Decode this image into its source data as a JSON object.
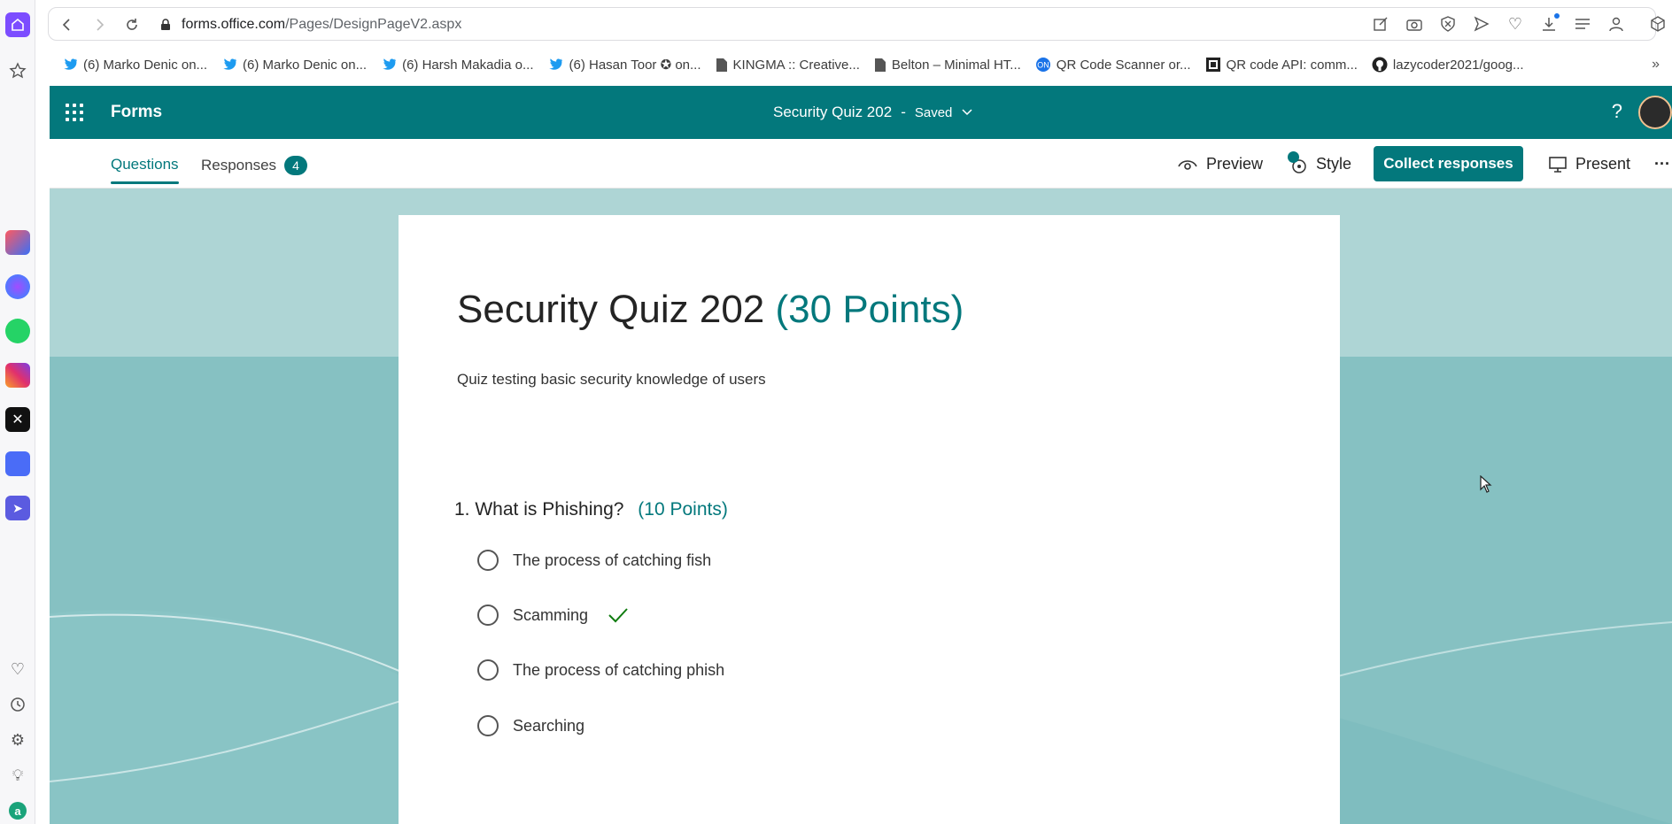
{
  "browser": {
    "url_host": "forms.office.com",
    "url_path": "/Pages/DesignPageV2.aspx",
    "bookmarks": [
      {
        "label": "(6) Marko Denic on...",
        "icon": "twitter-icon"
      },
      {
        "label": "(6) Marko Denic on...",
        "icon": "twitter-icon"
      },
      {
        "label": "(6) Harsh Makadia o...",
        "icon": "twitter-icon"
      },
      {
        "label": "(6) Hasan Toor ✪ on...",
        "icon": "twitter-icon"
      },
      {
        "label": "KINGMA :: Creative...",
        "icon": "document-icon"
      },
      {
        "label": "Belton – Minimal HT...",
        "icon": "document-icon"
      },
      {
        "label": "QR Code Scanner or...",
        "icon": "qr-scanner-icon"
      },
      {
        "label": "QR code API: comm...",
        "icon": "qr-code-icon"
      },
      {
        "label": "lazycoder2021/goog...",
        "icon": "github-icon"
      }
    ]
  },
  "forms_header": {
    "app_name": "Forms",
    "doc_title": "Security Quiz 202",
    "separator": "-",
    "status": "Saved"
  },
  "command_bar": {
    "tab_questions": "Questions",
    "tab_responses": "Responses",
    "responses_count": "4",
    "preview_label": "Preview",
    "style_label": "Style",
    "collect_label": "Collect responses",
    "present_label": "Present"
  },
  "form": {
    "title": "Security Quiz 202",
    "title_points": "(30 Points)",
    "description": "Quiz testing basic security knowledge of users",
    "questions": [
      {
        "number_title": "1. What is Phishing?",
        "points": "(10 Points)",
        "options": [
          {
            "label": "The process of catching fish",
            "correct": false
          },
          {
            "label": "Scamming",
            "correct": true
          },
          {
            "label": "The process of catching phish",
            "correct": false
          },
          {
            "label": "Searching",
            "correct": false
          }
        ]
      }
    ]
  },
  "colors": {
    "brand": "#03787c",
    "correct": "#107c10",
    "sidebar_home": "#7c4dff"
  }
}
